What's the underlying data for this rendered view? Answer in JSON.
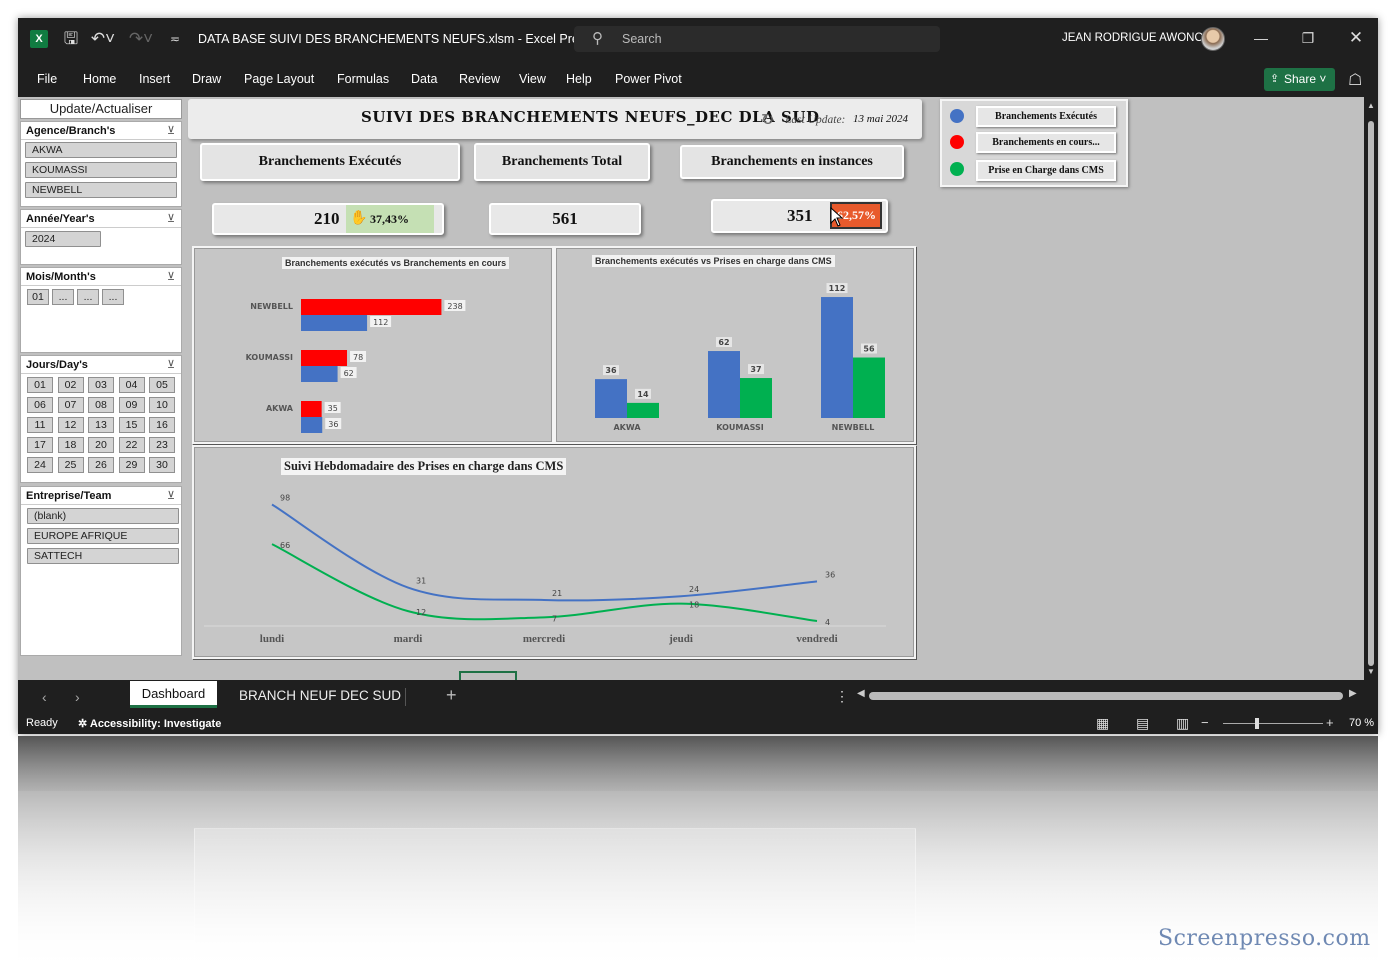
{
  "window": {
    "title": "DATA BASE SUIVI DES BRANCHEMENTS NEUFS.xlsm  -  Excel Pre...",
    "search_placeholder": "Search",
    "user_name": "JEAN RODRIGUE AWONO"
  },
  "menu": {
    "items": [
      "File",
      "Home",
      "Insert",
      "Draw",
      "Page Layout",
      "Formulas",
      "Data",
      "Review",
      "View",
      "Help",
      "Power Pivot"
    ],
    "share_label": "Share"
  },
  "slicers": {
    "update_button": "Update/Actualiser",
    "agence": {
      "header": "Agence/Branch's",
      "items": [
        "AKWA",
        "KOUMASSI",
        "NEWBELL"
      ]
    },
    "annee": {
      "header": "Année/Year's",
      "items": [
        "2024"
      ]
    },
    "mois": {
      "header": "Mois/Month's",
      "items": [
        "01",
        "...",
        "...",
        "..."
      ]
    },
    "jours": {
      "header": "Jours/Day's",
      "items": [
        "01",
        "02",
        "03",
        "04",
        "05",
        "06",
        "07",
        "08",
        "09",
        "10",
        "11",
        "12",
        "13",
        "15",
        "16",
        "17",
        "18",
        "20",
        "22",
        "23",
        "24",
        "25",
        "26",
        "29",
        "30"
      ]
    },
    "entreprise": {
      "header": "Entreprise/Team",
      "items": [
        "(blank)",
        "EUROPE AFRIQUE",
        "SATTECH"
      ]
    }
  },
  "dashboard": {
    "title": "SUIVI DES BRANCHEMENTS NEUFS_DEC DLA SUD",
    "last_update_label": "Last Update:",
    "last_update_date": "13 mai 2024",
    "kpi": {
      "executes": {
        "label": "Branchements Exécutés",
        "value": "210",
        "pct": "37,43%"
      },
      "total": {
        "label": "Branchements Total",
        "value": "561"
      },
      "instances": {
        "label": "Branchements en instances",
        "value": "351",
        "pct": "62,57%"
      }
    },
    "legend": [
      {
        "label": "Branchements Exécutés",
        "color": "#4472c4"
      },
      {
        "label": "Branchements en cours...",
        "color": "#ff0000"
      },
      {
        "label": "Prise  en Charge dans CMS",
        "color": "#00b050"
      }
    ]
  },
  "chart_data": [
    {
      "type": "bar",
      "orientation": "horizontal",
      "title": "Branchements exécutés vs Branchements en cours",
      "categories": [
        "NEWBELL",
        "KOUMASSI",
        "AKWA"
      ],
      "series": [
        {
          "values": [
            238,
            78,
            35
          ],
          "color": "#ff0000"
        },
        {
          "values": [
            112,
            62,
            36
          ],
          "color": "#4472c4"
        }
      ]
    },
    {
      "type": "bar",
      "title": "Branchements exécutés vs Prises en charge dans CMS",
      "categories": [
        "AKWA",
        "KOUMASSI",
        "NEWBELL"
      ],
      "series": [
        {
          "values": [
            36,
            62,
            112
          ],
          "color": "#4472c4"
        },
        {
          "values": [
            14,
            37,
            56
          ],
          "color": "#00b050"
        }
      ]
    },
    {
      "type": "line",
      "title": "Suivi Hebdomadaire des Prises en charge  dans CMS",
      "x": [
        "lundi",
        "mardi",
        "mercredi",
        "jeudi",
        "vendredi"
      ],
      "series": [
        {
          "values": [
            98,
            31,
            21,
            24,
            36
          ],
          "color": "#4472c4"
        },
        {
          "values": [
            66,
            12,
            7,
            18,
            4
          ],
          "color": "#00b050"
        }
      ]
    }
  ],
  "sheet_tabs": [
    "Dashboard",
    "BRANCH NEUF DEC SUD"
  ],
  "status": {
    "ready": "Ready",
    "accessibility": "Accessibility: Investigate",
    "zoom": "70 %"
  },
  "watermark": "Screenpresso.com"
}
